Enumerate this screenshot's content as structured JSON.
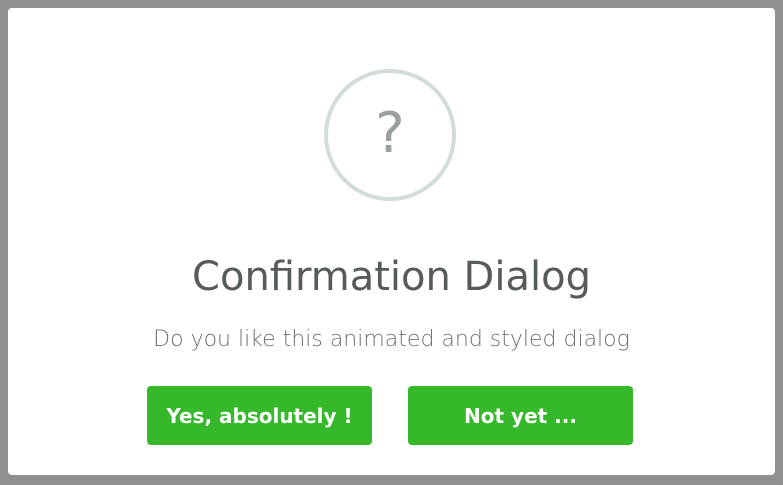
{
  "dialog": {
    "icon": "question-mark-icon",
    "icon_glyph": "?",
    "title": "Confirmation Dialog",
    "message": "Do you like this animated and styled dialog",
    "confirm_label": "Yes, absolutely !",
    "cancel_label": "Not yet ...",
    "colors": {
      "button": "#35b92a",
      "backdrop": "#8f9190",
      "icon_ring": "#d2dcd8",
      "title_text": "#555a5a"
    }
  }
}
